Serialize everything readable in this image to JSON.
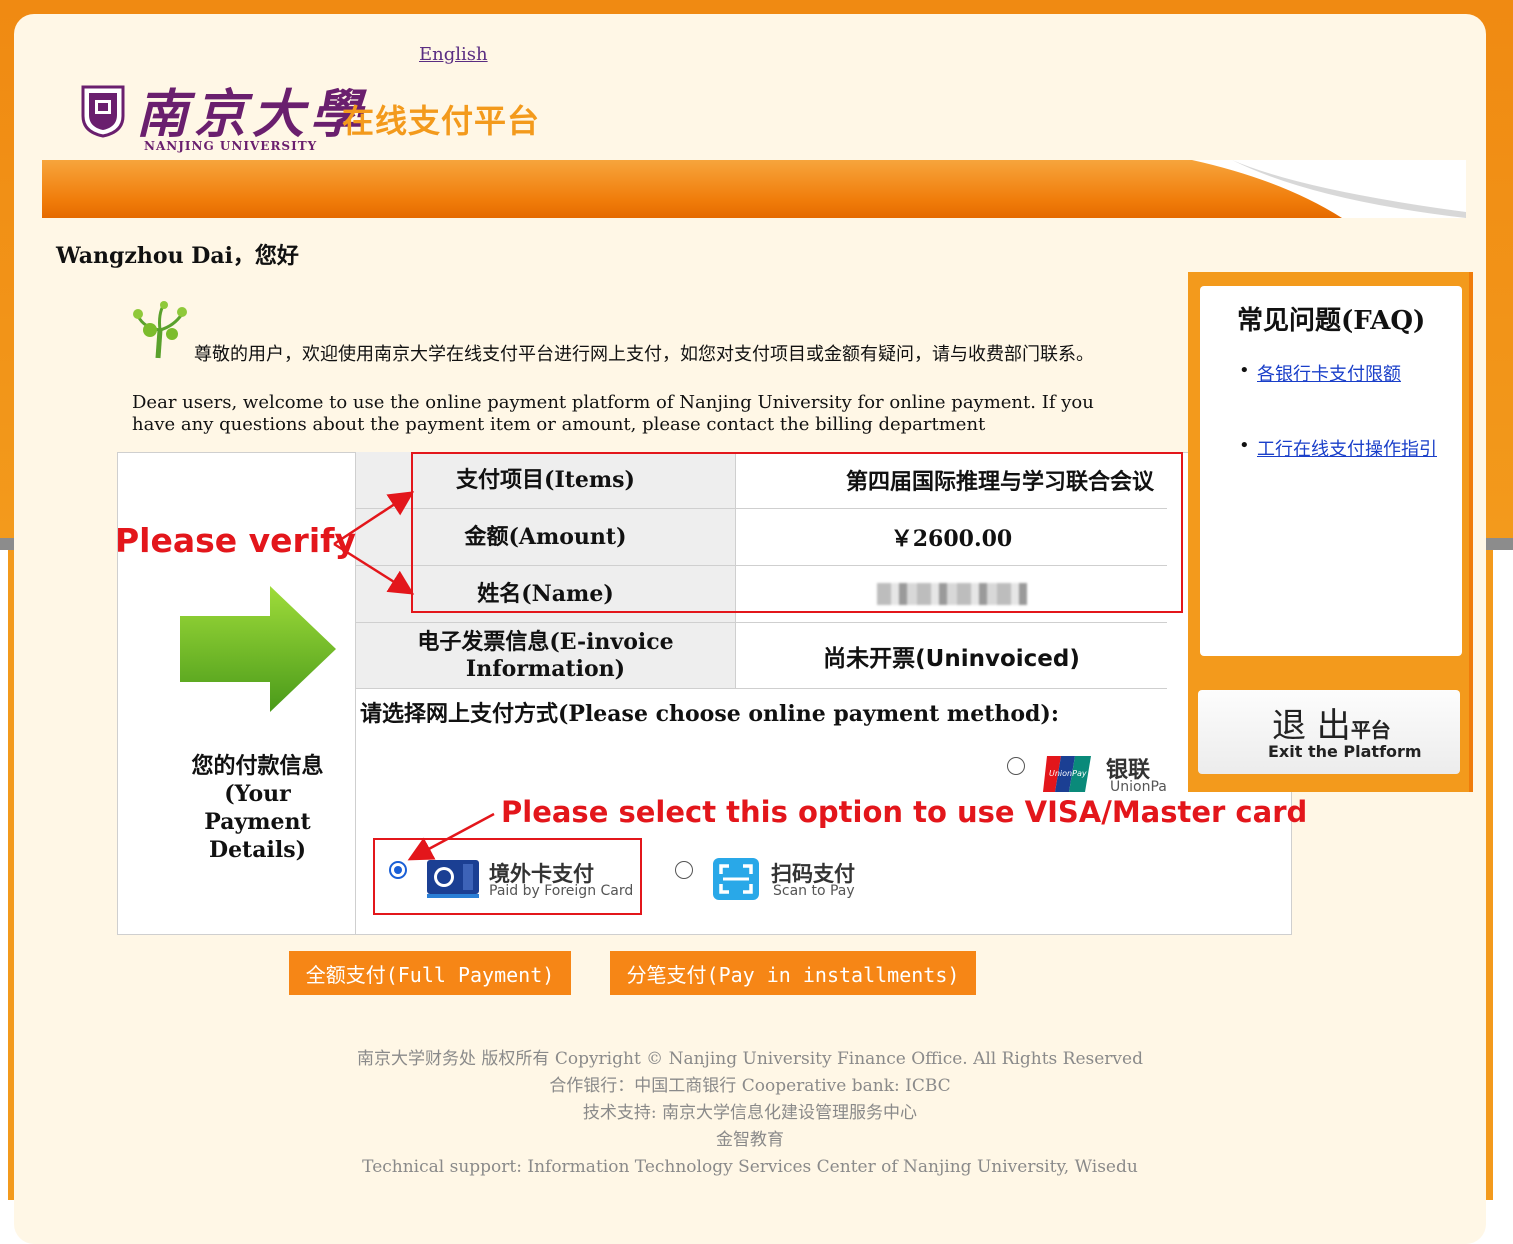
{
  "header": {
    "language_link": "English",
    "logo_cn": "南京大學",
    "logo_en": "NANJING UNIVERSITY",
    "platform_title": "在线支付平台"
  },
  "greeting": "Wangzhou Dai，您好",
  "welcome": {
    "cn": "尊敬的用户，欢迎使用南京大学在线支付平台进行网上支付，如您对支付项目或金额有疑问，请与收费部门联系。",
    "en": "Dear users, welcome to use the online payment platform of Nanjing University for online payment. If you have any questions about the payment item or amount, please contact the billing department"
  },
  "payment_details": {
    "heading": "您的付款信息(Your Payment Details)",
    "rows": [
      {
        "label": "支付项目(Items)",
        "value": "第四届国际推理与学习联合会议"
      },
      {
        "label": "金额(Amount)",
        "value": "￥2600.00"
      },
      {
        "label": "姓名(Name)",
        "value": ""
      },
      {
        "label": "电子发票信息(E-invoice Information)",
        "value": "尚未开票(Uninvoiced)"
      }
    ]
  },
  "payment_method": {
    "prompt": "请选择网上支付方式(Please choose online payment method):",
    "options": [
      {
        "title": "银联",
        "subtitle": "UnionPa",
        "selected": false
      },
      {
        "title": "境外卡支付",
        "subtitle": "Paid by Foreign Card",
        "selected": true
      },
      {
        "title": "扫码支付",
        "subtitle": "Scan to Pay",
        "selected": false
      }
    ]
  },
  "annotations": {
    "verify": "Please verify",
    "select_option": "Please select this option to use VISA/Master card"
  },
  "buttons": {
    "full_payment": "全额支付(Full Payment)",
    "installments": "分笔支付(Pay in installments)"
  },
  "footer": {
    "lines": [
      "南京大学财务处 版权所有 Copyright © Nanjing University Finance Office. All Rights Reserved",
      "合作银行：中国工商银行 Cooperative bank: ICBC",
      "技术支持: 南京大学信息化建设管理服务中心",
      "金智教育",
      "Technical support: Information Technology Services Center of Nanjing University, Wisedu"
    ]
  },
  "faq": {
    "title": "常见问题(FAQ)",
    "links": [
      "各银行卡支付限额",
      "工行在线支付操作指引"
    ],
    "exit_cn": "退 出",
    "exit_cn_small": "平台",
    "exit_en": "Exit the Platform"
  },
  "colors": {
    "accent_orange": "#f39a1c",
    "annotation_red": "#e3161b",
    "brand_purple": "#6a1f6e"
  }
}
